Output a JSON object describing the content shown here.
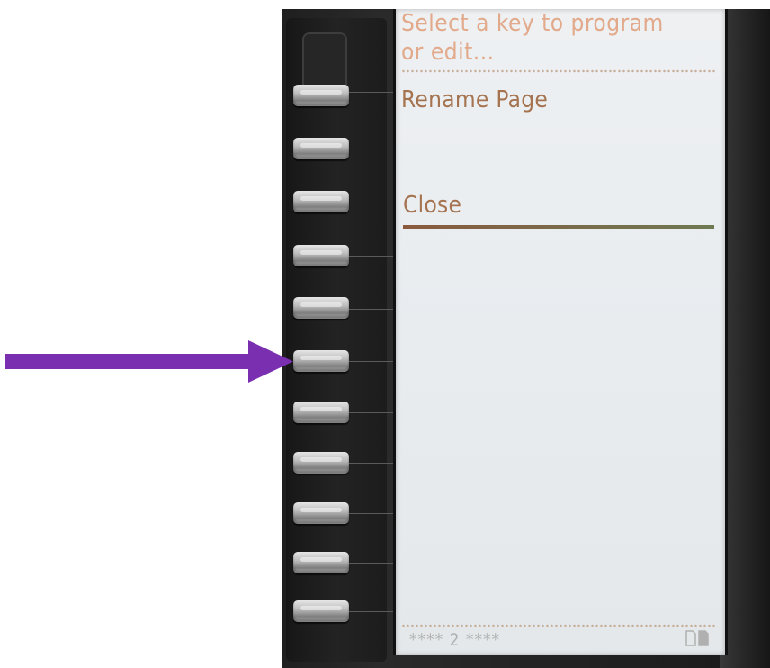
{
  "screen": {
    "prompt_line1": "Select a key to program",
    "prompt_line2": "or edit...",
    "items": [
      {
        "label": "Rename Page"
      },
      {
        "label": "Close"
      }
    ],
    "status_text": "**** 2 ****",
    "page_icons": "page-icons"
  },
  "colors": {
    "arrow": "#7a2fb0",
    "prompt_text": "#e2a98a",
    "item_text": "#a5734f"
  }
}
